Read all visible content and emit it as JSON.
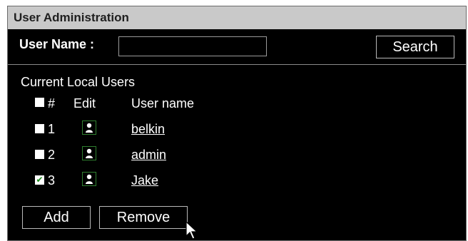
{
  "title": "User Administration",
  "search": {
    "label": "User Name :",
    "value": "",
    "placeholder": "",
    "button_label": "Search"
  },
  "users_section": {
    "title": "Current Local Users",
    "headers": {
      "number": "#",
      "edit": "Edit",
      "name": "User name"
    },
    "rows": [
      {
        "number": "1",
        "name": "belkin",
        "checked": false
      },
      {
        "number": "2",
        "name": "admin",
        "checked": false
      },
      {
        "number": "3",
        "name": "Jake",
        "checked": true
      }
    ]
  },
  "actions": {
    "add_label": "Add",
    "remove_label": "Remove"
  },
  "colors": {
    "title_bar_bg": "#c9c9c9",
    "panel_bg": "#000000",
    "edit_icon_border": "#2f7f2f",
    "check_mark": "#1a8a1a"
  },
  "icons": {
    "edit": "user-edit-icon",
    "cursor": "mouse-pointer-icon",
    "check": "check-icon"
  }
}
